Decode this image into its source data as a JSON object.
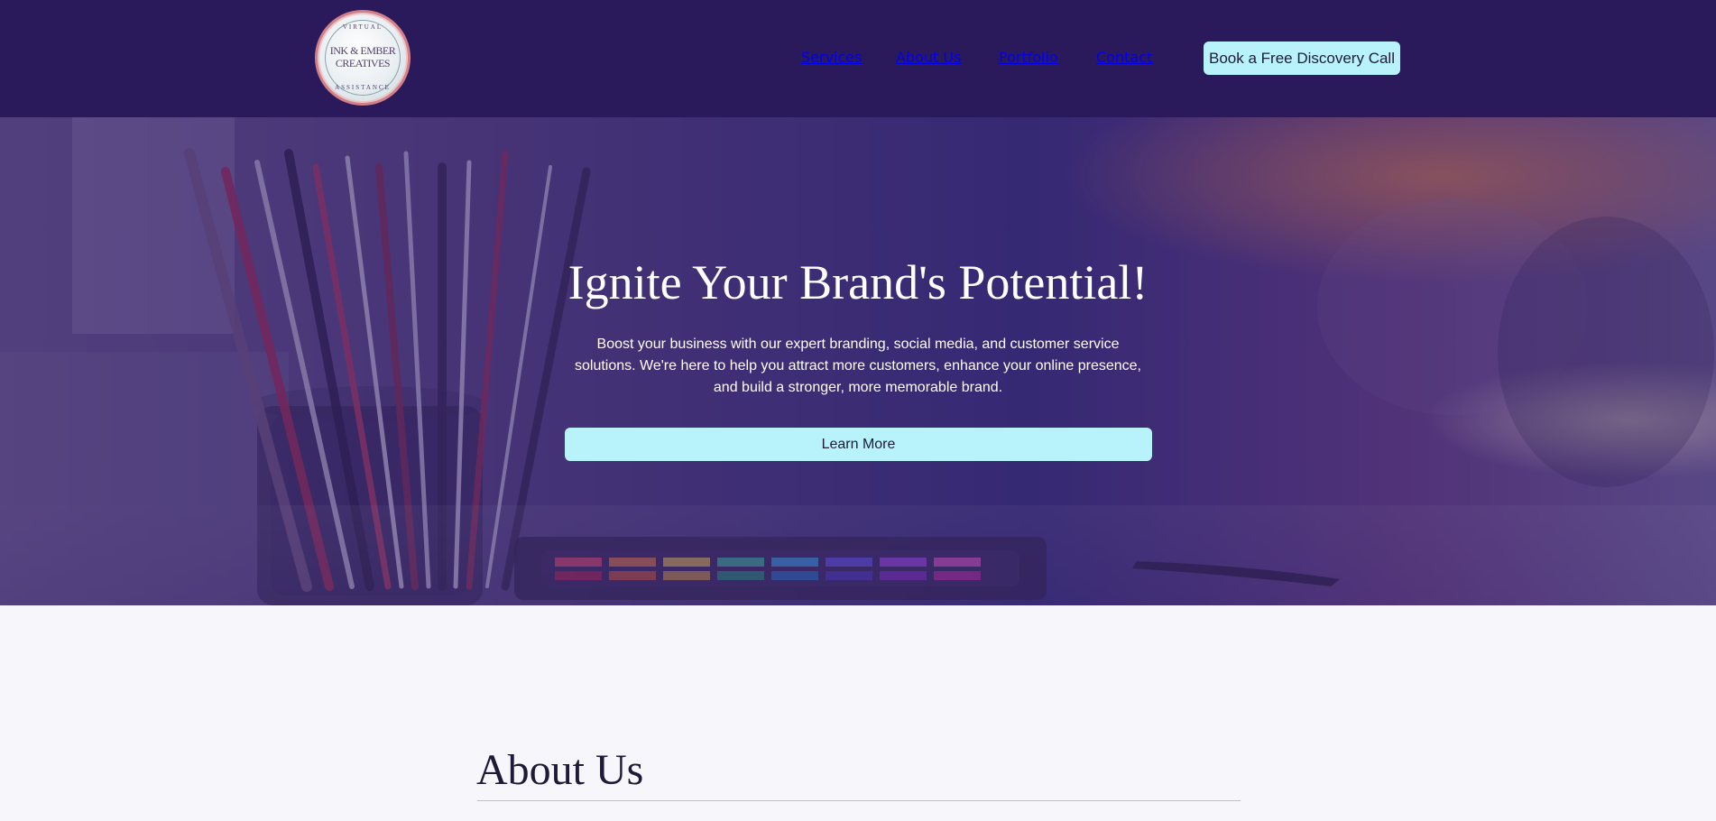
{
  "header": {
    "logo": {
      "top_text": "VIRTUAL",
      "main_text_line1": "INK & EMBER",
      "main_text_line2": "CREATIVES",
      "bottom_text": "ASSISTANCE",
      "brand_colors": {
        "ring": "#d27f88",
        "text": "#4f3f6b"
      }
    },
    "nav": {
      "items": [
        {
          "label": "Services"
        },
        {
          "label": "About Us"
        },
        {
          "label": "Portfolio"
        },
        {
          "label": "Contact"
        }
      ]
    },
    "cta_label": "Book a Free Discovery Call",
    "background_color": "#2b1a5b",
    "cta_color": "#b8f3fb"
  },
  "hero": {
    "title": "Ignite Your Brand's Potential!",
    "text": "Boost your business with our expert branding, social media, and customer service solutions. We're here to help you attract more customers, enhance your online presence, and build a stronger, more memorable brand.",
    "button_label": "Learn More",
    "overlay_color": "#3c286e"
  },
  "about": {
    "title": "About Us"
  }
}
